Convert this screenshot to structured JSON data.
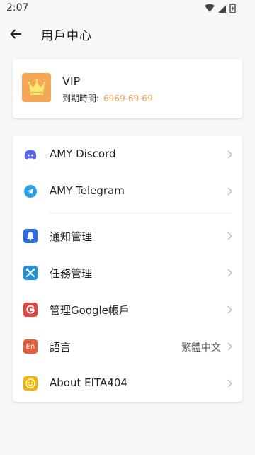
{
  "status_bar": {
    "time": "2:07"
  },
  "header": {
    "title": "用戶中心"
  },
  "vip": {
    "title": "VIP",
    "expiry_label": "到期時間:",
    "expiry_value": "6969-69-69"
  },
  "menu": {
    "items": [
      {
        "label": "AMY Discord",
        "icon": "discord-icon",
        "color": "#5865f2"
      },
      {
        "label": "AMY Telegram",
        "icon": "telegram-icon",
        "color": "#2aa3e0"
      },
      {
        "label": "通知管理",
        "icon": "bell-icon",
        "color": "#2f6fe6"
      },
      {
        "label": "任務管理",
        "icon": "tools-icon",
        "color": "#1f8fe0"
      },
      {
        "label": "管理Google帳戶",
        "icon": "google-g-icon",
        "color": "#e5443b"
      },
      {
        "label": "語言",
        "icon": "language-en-icon",
        "color": "#e55f3a",
        "value": "繁體中文",
        "icon_text": "En"
      },
      {
        "label": "About EITA404",
        "icon": "smiley-icon",
        "color": "#f5b400"
      }
    ]
  }
}
